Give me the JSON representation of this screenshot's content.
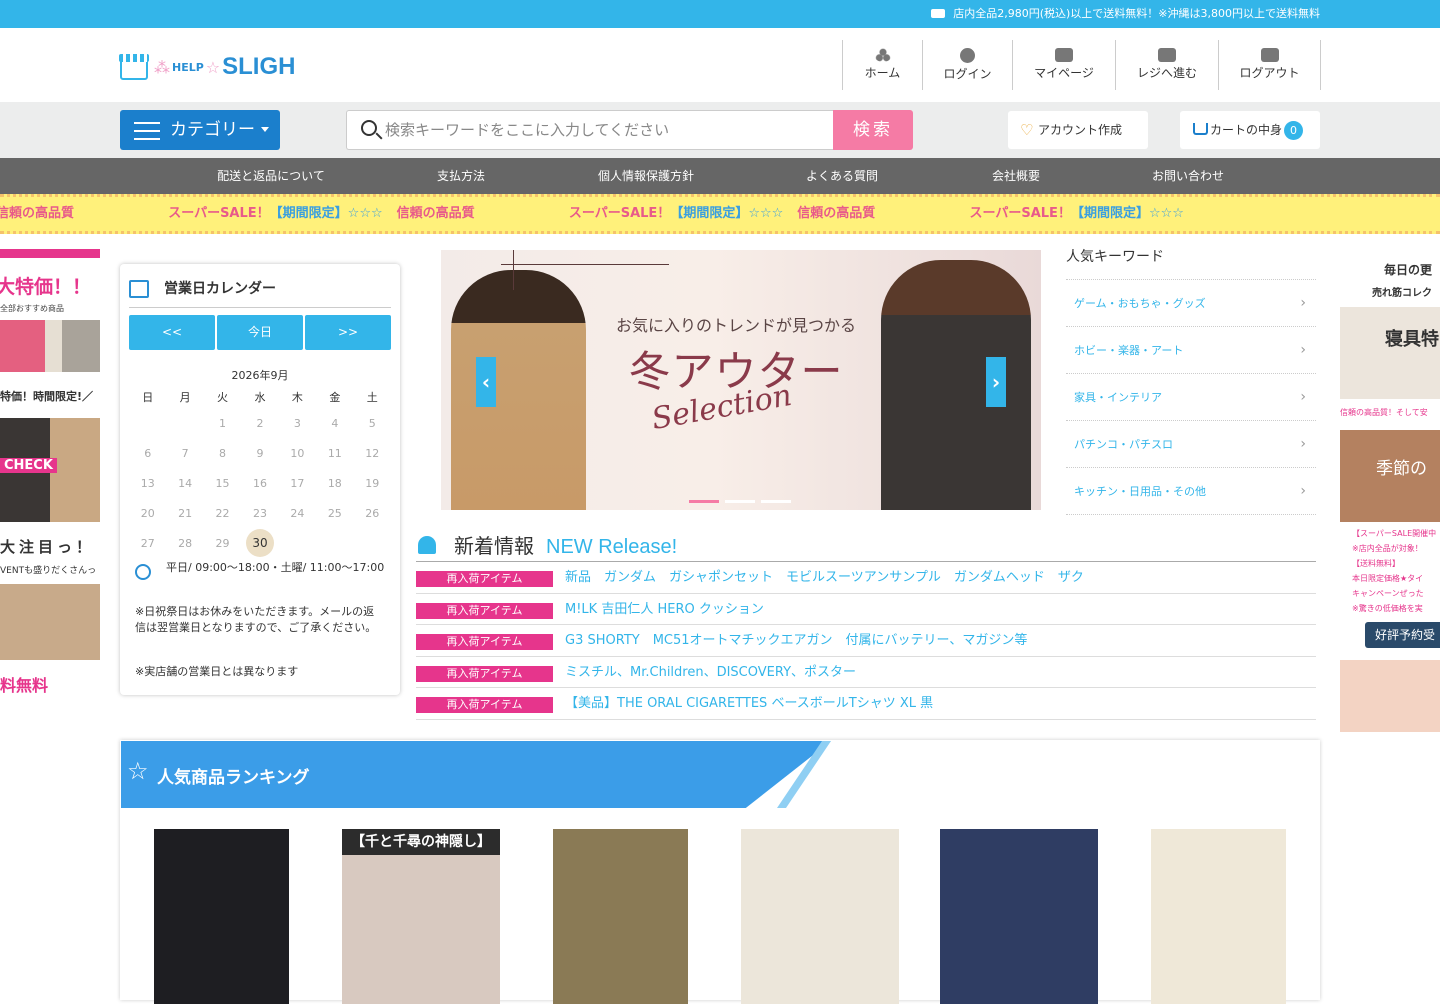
{
  "topbar": {
    "notice": "店内全品2,980円(税込)以上で送料無料！※沖縄は3,800円以上で送料無料"
  },
  "logo": {
    "prefix": "HELP",
    "star": "☆",
    "name": "SLIGH"
  },
  "header_nav": [
    {
      "label": "ホーム",
      "icon": "home-icon"
    },
    {
      "label": "ログイン",
      "icon": "user-icon"
    },
    {
      "label": "マイページ",
      "icon": "id-card-icon"
    },
    {
      "label": "レジへ進む",
      "icon": "register-icon"
    },
    {
      "label": "ログアウト",
      "icon": "logout-icon"
    }
  ],
  "search": {
    "category_label": "カテゴリー",
    "placeholder": "検索キーワードをここに入力してください",
    "button": "検索"
  },
  "account": {
    "create_label": "アカウント作成"
  },
  "cart": {
    "label": "カートの中身",
    "count": "0"
  },
  "global_nav": [
    "配送と返品について",
    "支払方法",
    "個人情報保護方針",
    "よくある質問",
    "会社概要",
    "お問い合わせ"
  ],
  "ribbon": {
    "a": "スーパーSALE！",
    "b": "【期間限定】☆☆☆",
    "c": "信頼の高品質"
  },
  "left_banner": {
    "title": "大特価！！",
    "sub": "全部おすすめ商品",
    "t3": "特価！時間限定!／",
    "check": "CHECK",
    "t4": "大注目っ！",
    "t5": "VENTも盛りだくさんっ",
    "t6": "料無料"
  },
  "calendar": {
    "title": "営業日カレンダー",
    "prev": "<<",
    "today": "今日",
    "next": ">>",
    "month": "2026年9月",
    "weekdays": [
      "日",
      "月",
      "火",
      "水",
      "木",
      "金",
      "土"
    ],
    "weeks": [
      [
        "",
        "",
        "1",
        "2",
        "3",
        "4",
        "5"
      ],
      [
        "6",
        "7",
        "8",
        "9",
        "10",
        "11",
        "12"
      ],
      [
        "13",
        "14",
        "15",
        "16",
        "17",
        "18",
        "19"
      ],
      [
        "20",
        "21",
        "22",
        "23",
        "24",
        "25",
        "26"
      ],
      [
        "27",
        "28",
        "29",
        "30",
        "",
        "",
        ""
      ]
    ],
    "today_day": "30",
    "hours": "平日/ 09:00～18:00・土曜/ 11:00～17:00",
    "note1": "※日祝祭日はお休みをいただきます。メールの返信は翌営業日となりますので、ご了承ください。",
    "note2": "※実店舗の営業日とは異なります"
  },
  "hero": {
    "subtitle": "お気に入りのトレンドが見つかる",
    "title": "冬アウター",
    "script": "Selection",
    "prev": "‹",
    "next": "›"
  },
  "keywords": {
    "title": "人気キーワード",
    "items": [
      "ゲーム・おもちゃ・グッズ",
      "ホビー・楽器・アート",
      "家具・インテリア",
      "パチンコ・パチスロ",
      "キッチン・日用品・その他"
    ]
  },
  "right_banner": {
    "t1": "毎日の更",
    "t2": "売れ筋コレク",
    "bed": "寝具特",
    "t3": "信頼の高品質！そして安",
    "season": "季節の",
    "lines": [
      "【スーパーSALE開催中",
      "※店内全品が対象！",
      "【送料無料】",
      "本日限定価格★タイ",
      "キャンペーンぜった",
      "※驚きの低価格を実"
    ],
    "btn": "好評予約受"
  },
  "news": {
    "title": "新着情報",
    "title_en": "NEW Release!",
    "tag": "再入荷アイテム",
    "items": [
      "新品　ガンダム　ガシャポンセット　モビルスーツアンサンプル　ガンダムヘッド　ザク",
      "M!LK 吉田仁人 HERO クッション",
      "G3 SHORTY　MC51オートマチックエアガン　付属にバッテリー、マガジン等",
      "ミスチル、Mr.Children、DISCOVERY、ポスター",
      "【美品】THE ORAL CIGARETTES ベースボールTシャツ XL 黒"
    ]
  },
  "ranking": {
    "title": "人気商品ランキング",
    "products": [
      {
        "name": "product-black-tshirt",
        "color": "#1e1e22",
        "caption": ""
      },
      {
        "name": "product-plush-bunny",
        "color": "#d8c9c0",
        "caption": "【千と千尋の神隠し】"
      },
      {
        "name": "product-babel-folder",
        "color": "#8a7a55",
        "caption": ""
      },
      {
        "name": "product-tote-bag",
        "color": "#ece6da",
        "caption": ""
      },
      {
        "name": "product-rabbit-plush",
        "color": "#2f3d63",
        "caption": ""
      },
      {
        "name": "product-doraemon-figure",
        "color": "#efe8d8",
        "caption": ""
      }
    ]
  }
}
